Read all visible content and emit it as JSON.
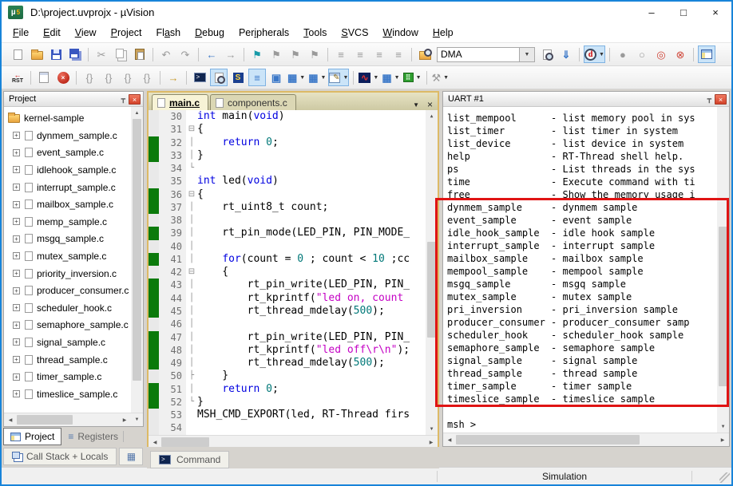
{
  "window": {
    "title": "D:\\project.uvprojx - µVision"
  },
  "menu": [
    {
      "label": "File",
      "accel": 0
    },
    {
      "label": "Edit",
      "accel": 0
    },
    {
      "label": "View",
      "accel": 0
    },
    {
      "label": "Project",
      "accel": 0
    },
    {
      "label": "Flash",
      "accel": 2
    },
    {
      "label": "Debug",
      "accel": 0
    },
    {
      "label": "Peripherals",
      "accel": 3
    },
    {
      "label": "Tools",
      "accel": 0
    },
    {
      "label": "SVCS",
      "accel": 0
    },
    {
      "label": "Window",
      "accel": 0
    },
    {
      "label": "Help",
      "accel": 0
    }
  ],
  "toolbar": {
    "find_value": "DMA",
    "rst_label": "RST",
    "debug_letter": "d"
  },
  "icons": {
    "minimize": "–",
    "maximize": "□",
    "close": "×",
    "caret": "▼",
    "x": "×",
    "gt": ">",
    "s": "S",
    "pencil": "✎",
    "wave": "∿",
    "dots": "⠿",
    "back": "←",
    "up": "▲",
    "down": "▼",
    "left": "◀",
    "right": "▶",
    "pin": "┳",
    "plus": "+",
    "tab_menu": "▼",
    "tab_close": "×",
    "logo_mu": "µ",
    "logo_5": "5"
  },
  "toolbar1": [
    {
      "t": "btn",
      "name": "new-file",
      "icon": "page"
    },
    {
      "t": "btn",
      "name": "open-file",
      "icon": "folder"
    },
    {
      "t": "btn",
      "name": "save",
      "icon": "floppy"
    },
    {
      "t": "btn",
      "name": "save-all",
      "icon": "floppy2"
    },
    {
      "t": "sep"
    },
    {
      "t": "btn",
      "name": "cut",
      "g": "✂",
      "c": "dim"
    },
    {
      "t": "btn",
      "name": "copy",
      "icon": "copy"
    },
    {
      "t": "btn",
      "name": "paste",
      "icon": "paste"
    },
    {
      "t": "sep"
    },
    {
      "t": "btn",
      "name": "undo",
      "g": "↶",
      "c": "dim"
    },
    {
      "t": "btn",
      "name": "redo",
      "g": "↷",
      "c": "dim"
    },
    {
      "t": "sep"
    },
    {
      "t": "btn",
      "name": "navigate-back",
      "g": "←",
      "c": "blue"
    },
    {
      "t": "btn",
      "name": "navigate-forward",
      "g": "→",
      "c": "dim"
    },
    {
      "t": "sep"
    },
    {
      "t": "btn",
      "name": "toggle-bookmark",
      "g": "⚑",
      "c": "teal"
    },
    {
      "t": "btn",
      "name": "previous-bookmark",
      "g": "⚑",
      "c": "dim"
    },
    {
      "t": "btn",
      "name": "next-bookmark",
      "g": "⚑",
      "c": "dim"
    },
    {
      "t": "btn",
      "name": "clear-bookmarks",
      "g": "⚑",
      "c": "dim"
    },
    {
      "t": "sep"
    },
    {
      "t": "btn",
      "name": "indent",
      "g": "≡",
      "c": "dim"
    },
    {
      "t": "btn",
      "name": "outdent",
      "g": "≡",
      "c": "dim"
    },
    {
      "t": "btn",
      "name": "comment",
      "g": "≡",
      "c": "dim"
    },
    {
      "t": "btn",
      "name": "uncomment",
      "g": "≡",
      "c": "dim"
    },
    {
      "t": "sep"
    },
    {
      "t": "btn",
      "name": "find-in-files",
      "icon": "foldermag"
    },
    {
      "t": "combo",
      "name": "find-combo"
    },
    {
      "t": "btn",
      "name": "find",
      "icon": "pagemag"
    },
    {
      "t": "btn",
      "name": "incremental-find",
      "g": "⇓",
      "c": "blue"
    },
    {
      "t": "sep"
    },
    {
      "t": "btn",
      "name": "start-stop-debug",
      "icon": "debugmag",
      "hl": true,
      "caret": true
    },
    {
      "t": "sep"
    },
    {
      "t": "btn",
      "name": "toggle-breakpoint",
      "g": "●",
      "c": "dim"
    },
    {
      "t": "btn",
      "name": "enable-disable-breakpoint",
      "g": "○",
      "c": "dim"
    },
    {
      "t": "btn",
      "name": "disable-all-breakpoints",
      "g": "◎",
      "c": "red"
    },
    {
      "t": "btn",
      "name": "kill-all-breakpoints",
      "g": "⊗",
      "c": "red"
    },
    {
      "t": "sep"
    },
    {
      "t": "btn",
      "name": "project-window",
      "icon": "projwin",
      "hl": true
    }
  ],
  "toolbar2": [
    {
      "t": "btn",
      "name": "reset",
      "icon": "rst"
    },
    {
      "t": "sep"
    },
    {
      "t": "btn",
      "name": "show-next-statement",
      "icon": "doclist"
    },
    {
      "t": "btn",
      "name": "stop-debug",
      "icon": "stop"
    },
    {
      "t": "sep"
    },
    {
      "t": "btn",
      "name": "step",
      "g": "{}",
      "c": "dim"
    },
    {
      "t": "btn",
      "name": "step-over",
      "g": "{}",
      "c": "dim"
    },
    {
      "t": "btn",
      "name": "step-out",
      "g": "{}",
      "c": "dim"
    },
    {
      "t": "btn",
      "name": "run-to-cursor",
      "g": "{}",
      "c": "dim"
    },
    {
      "t": "sep"
    },
    {
      "t": "btn",
      "name": "run",
      "g": "→",
      "c": "gold"
    },
    {
      "t": "sep"
    },
    {
      "t": "btn",
      "name": "command-window",
      "icon": "console"
    },
    {
      "t": "btn",
      "name": "disassembly-window",
      "icon": "pagemag",
      "hl": true
    },
    {
      "t": "btn",
      "name": "symbol-window",
      "icon": "symbols"
    },
    {
      "t": "btn",
      "name": "registers-window",
      "g": "≡",
      "c": "blue",
      "hl": true
    },
    {
      "t": "btn",
      "name": "call-stack-window",
      "g": "▣",
      "c": "blue"
    },
    {
      "t": "btn",
      "name": "watch-window",
      "g": "▦",
      "c": "blue",
      "caret": true
    },
    {
      "t": "btn",
      "name": "memory-window",
      "g": "▦",
      "c": "blue",
      "caret": true
    },
    {
      "t": "btn",
      "name": "serial-windows",
      "icon": "serial",
      "hl": true,
      "caret": true
    },
    {
      "t": "sep"
    },
    {
      "t": "btn",
      "name": "analysis-windows",
      "icon": "wave",
      "caret": true
    },
    {
      "t": "btn",
      "name": "system-viewer",
      "g": "▦",
      "c": "blue",
      "caret": true
    },
    {
      "t": "btn",
      "name": "peripherals",
      "icon": "periph",
      "caret": true
    },
    {
      "t": "sep"
    },
    {
      "t": "btn",
      "name": "toolbox",
      "g": "⚒",
      "c": "dim",
      "caret": true
    }
  ],
  "project": {
    "caption": "Project",
    "root": "kernel-sample",
    "files": [
      "dynmem_sample.c",
      "event_sample.c",
      "idlehook_sample.c",
      "interrupt_sample.c",
      "mailbox_sample.c",
      "memp_sample.c",
      "msgq_sample.c",
      "mutex_sample.c",
      "priority_inversion.c",
      "producer_consumer.c",
      "scheduler_hook.c",
      "semaphore_sample.c",
      "signal_sample.c",
      "thread_sample.c",
      "timer_sample.c",
      "timeslice_sample.c"
    ],
    "tabs": [
      "Project",
      "Registers"
    ]
  },
  "bottom_tabs": {
    "callstack": "Call Stack + Locals",
    "command": "Command"
  },
  "editor": {
    "tabs": [
      "main.c",
      "components.c"
    ],
    "code": [
      {
        "n": "30",
        "segs": [
          [
            "k",
            "int"
          ],
          [
            "t",
            " main("
          ],
          [
            "k",
            "void"
          ],
          [
            "t",
            ")"
          ]
        ]
      },
      {
        "n": "31",
        "fold": "⊟",
        "segs": [
          [
            "t",
            "{"
          ]
        ]
      },
      {
        "n": "32",
        "bar": true,
        "fold": "│",
        "segs": [
          [
            "t",
            "    "
          ],
          [
            "k",
            "return"
          ],
          [
            "t",
            " "
          ],
          [
            "n",
            "0"
          ],
          [
            "t",
            ";"
          ]
        ]
      },
      {
        "n": "33",
        "bar": true,
        "fold": "│",
        "segs": [
          [
            "t",
            "}"
          ]
        ]
      },
      {
        "n": "34",
        "fold": "└",
        "segs": []
      },
      {
        "n": "35",
        "segs": [
          [
            "k",
            "int"
          ],
          [
            "t",
            " led("
          ],
          [
            "k",
            "void"
          ],
          [
            "t",
            ")"
          ]
        ]
      },
      {
        "n": "36",
        "bar": true,
        "fold": "⊟",
        "segs": [
          [
            "t",
            "{"
          ]
        ]
      },
      {
        "n": "37",
        "bar": true,
        "fold": "│",
        "segs": [
          [
            "t",
            "    rt_uint8_t count;"
          ]
        ]
      },
      {
        "n": "38",
        "fold": "│",
        "segs": []
      },
      {
        "n": "39",
        "bar": true,
        "fold": "│",
        "segs": [
          [
            "t",
            "    rt_pin_mode(LED_PIN, PIN_MODE_"
          ]
        ]
      },
      {
        "n": "40",
        "fold": "│",
        "segs": []
      },
      {
        "n": "41",
        "bar": true,
        "fold": "│",
        "segs": [
          [
            "t",
            "    "
          ],
          [
            "k",
            "for"
          ],
          [
            "t",
            "(count = "
          ],
          [
            "n",
            "0"
          ],
          [
            "t",
            " ; count < "
          ],
          [
            "n",
            "10"
          ],
          [
            "t",
            " ;cc"
          ]
        ]
      },
      {
        "n": "42",
        "fold": "⊟",
        "segs": [
          [
            "t",
            "    {"
          ]
        ]
      },
      {
        "n": "43",
        "bar": true,
        "fold": "│",
        "segs": [
          [
            "t",
            "        rt_pin_write(LED_PIN, PIN_"
          ]
        ]
      },
      {
        "n": "44",
        "bar": true,
        "fold": "│",
        "segs": [
          [
            "t",
            "        rt_kprintf("
          ],
          [
            "s",
            "\"led on, count"
          ]
        ]
      },
      {
        "n": "45",
        "bar": true,
        "fold": "│",
        "segs": [
          [
            "t",
            "        rt_thread_mdelay("
          ],
          [
            "n",
            "500"
          ],
          [
            "t",
            ");"
          ]
        ]
      },
      {
        "n": "46",
        "fold": "│",
        "segs": []
      },
      {
        "n": "47",
        "bar": true,
        "fold": "│",
        "segs": [
          [
            "t",
            "        rt_pin_write(LED_PIN, PIN_"
          ]
        ]
      },
      {
        "n": "48",
        "bar": true,
        "fold": "│",
        "segs": [
          [
            "t",
            "        rt_kprintf("
          ],
          [
            "s",
            "\"led off\\r\\n\""
          ],
          [
            "t",
            ");"
          ]
        ]
      },
      {
        "n": "49",
        "bar": true,
        "fold": "│",
        "segs": [
          [
            "t",
            "        rt_thread_mdelay("
          ],
          [
            "n",
            "500"
          ],
          [
            "t",
            ");"
          ]
        ]
      },
      {
        "n": "50",
        "fold": "├",
        "segs": [
          [
            "t",
            "    }"
          ]
        ]
      },
      {
        "n": "51",
        "bar": true,
        "fold": "│",
        "segs": [
          [
            "t",
            "    "
          ],
          [
            "k",
            "return"
          ],
          [
            "t",
            " "
          ],
          [
            "n",
            "0"
          ],
          [
            "t",
            ";"
          ]
        ]
      },
      {
        "n": "52",
        "bar": true,
        "fold": "└",
        "segs": [
          [
            "t",
            "}"
          ]
        ]
      },
      {
        "n": "53",
        "segs": [
          [
            "t",
            "MSH_CMD_EXPORT(led, RT-Thread firs"
          ]
        ]
      },
      {
        "n": "54",
        "segs": []
      }
    ]
  },
  "uart": {
    "caption": "UART #1",
    "lines": [
      {
        "name": "list_mempool",
        "desc": "- list memory pool in sys"
      },
      {
        "name": "list_timer",
        "desc": "- list timer in system"
      },
      {
        "name": "list_device",
        "desc": "- list device in system"
      },
      {
        "name": "help",
        "desc": "- RT-Thread shell help."
      },
      {
        "name": "ps",
        "desc": "- List threads in the sys"
      },
      {
        "name": "time",
        "desc": "- Execute command with ti"
      },
      {
        "name": "free",
        "desc": "- Show the memory usage i"
      },
      {
        "name": "dynmem_sample",
        "desc": "- dynmem sample"
      },
      {
        "name": "event_sample",
        "desc": "- event sample"
      },
      {
        "name": "idle_hook_sample",
        "desc": "- idle hook sample"
      },
      {
        "name": "interrupt_sample",
        "desc": "- interrupt sample"
      },
      {
        "name": "mailbox_sample",
        "desc": "- mailbox sample"
      },
      {
        "name": "mempool_sample",
        "desc": "- mempool sample"
      },
      {
        "name": "msgq_sample",
        "desc": "- msgq sample"
      },
      {
        "name": "mutex_sample",
        "desc": "- mutex sample"
      },
      {
        "name": "pri_inversion",
        "desc": "- pri_inversion sample"
      },
      {
        "name": "producer_consumer",
        "desc": "- producer_consumer samp"
      },
      {
        "name": "scheduler_hook",
        "desc": "- scheduler_hook sample"
      },
      {
        "name": "semaphore_sample",
        "desc": "- semaphore sample"
      },
      {
        "name": "signal_sample",
        "desc": "- signal sample"
      },
      {
        "name": "thread_sample",
        "desc": "- thread sample"
      },
      {
        "name": "timer_sample",
        "desc": "- timer sample"
      },
      {
        "name": "timeslice_sample",
        "desc": "- timeslice sample"
      }
    ],
    "prompt": "msh >"
  },
  "status": {
    "mode": "Simulation"
  }
}
